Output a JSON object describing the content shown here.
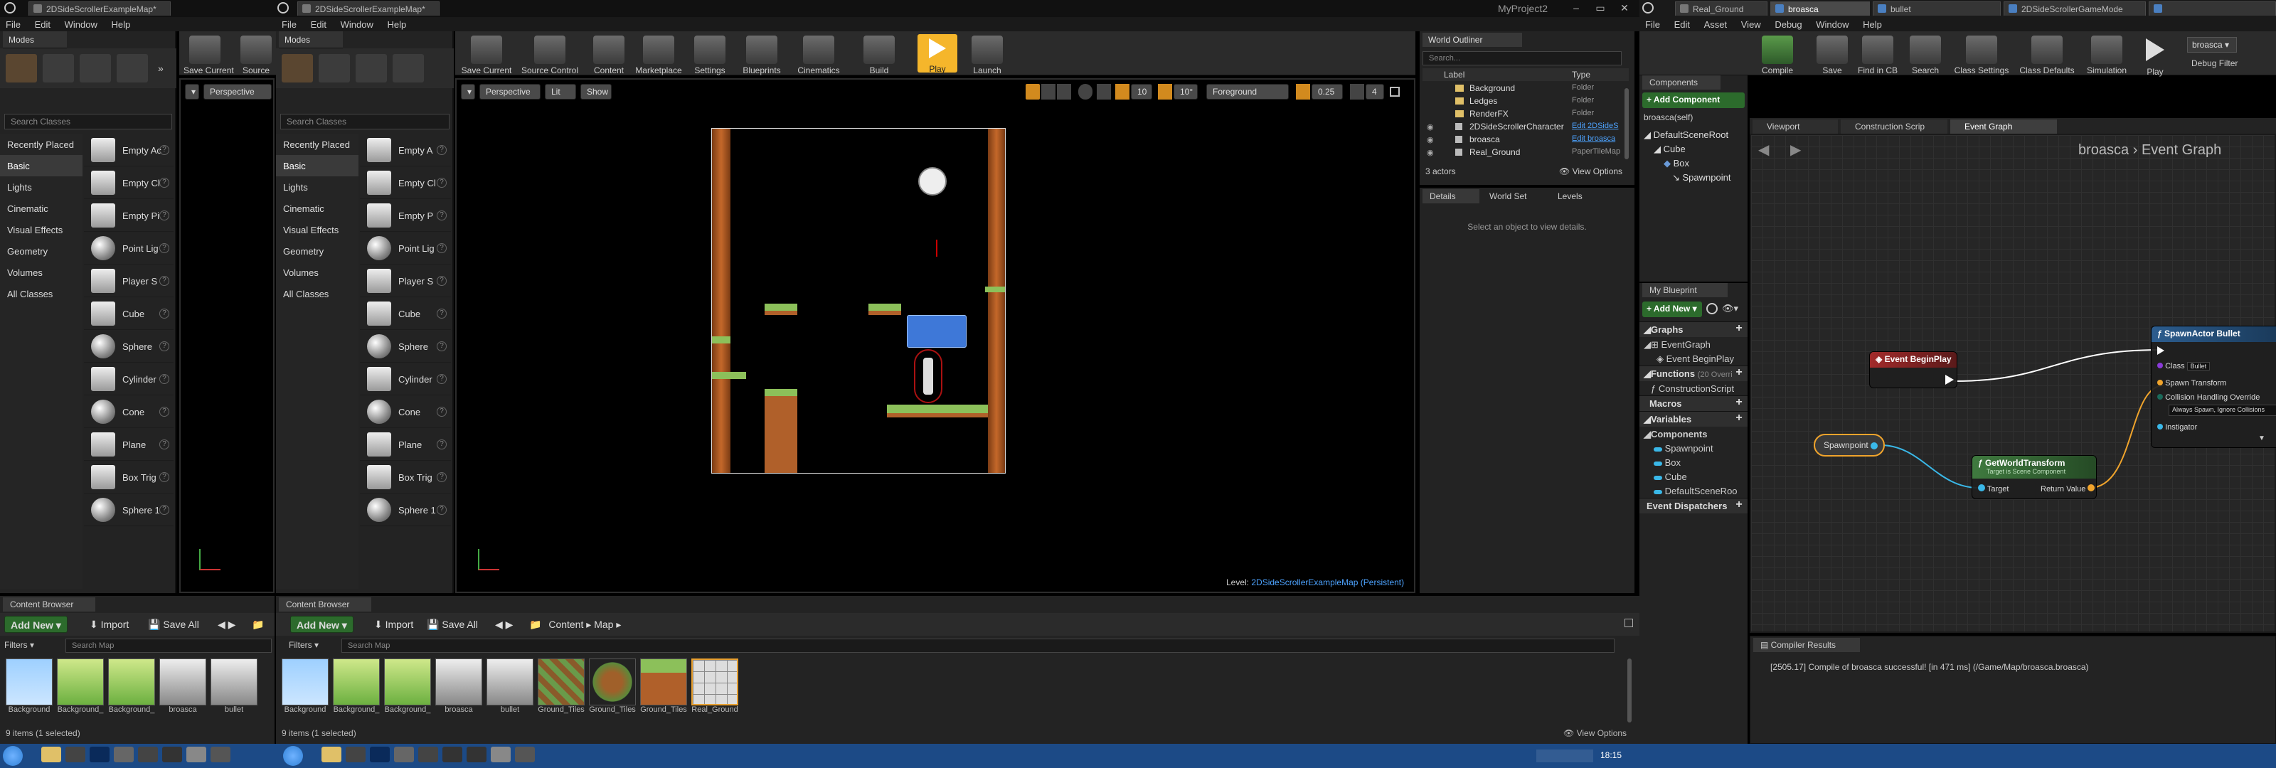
{
  "window1": {
    "tab_title": "2DSideScrollerExampleMap*",
    "modes_tab": "Modes",
    "menu": [
      "File",
      "Edit",
      "Window",
      "Help"
    ]
  },
  "window2": {
    "tab_title": "2DSideScrollerExampleMap*",
    "modes_tab": "Modes",
    "menu": [
      "File",
      "Edit",
      "Window",
      "Help"
    ],
    "project_name": "MyProject2"
  },
  "modes": {
    "search_placeholder": "Search Classes",
    "categories": [
      "Recently Placed",
      "Basic",
      "Lights",
      "Cinematic",
      "Visual Effects",
      "Geometry",
      "Volumes",
      "All Classes"
    ],
    "items": [
      "Empty A",
      "Empty Cl",
      "Empty P",
      "Point Lig",
      "Player S",
      "Cube",
      "Sphere",
      "Cylinder",
      "Cone",
      "Plane",
      "Box Trig",
      "Sphere 1"
    ],
    "items_left": [
      "Empty Ac",
      "Empty Cl",
      "Empty Pi",
      "Point Lig",
      "Player S",
      "Cube",
      "Sphere",
      "Cylinder",
      "Cone",
      "Plane",
      "Box Trig",
      "Sphere 1"
    ]
  },
  "toolbar": {
    "save_current": "Save Current",
    "source_control": "Source Control",
    "source_short": "Source",
    "content": "Content",
    "marketplace": "Marketplace",
    "settings": "Settings",
    "blueprints": "Blueprints",
    "cinematics": "Cinematics",
    "build": "Build",
    "play": "Play",
    "launch": "Launch"
  },
  "viewport": {
    "perspective": "Perspective",
    "lit": "Lit",
    "show": "Show",
    "grid_snap": "10",
    "rot_snap": "10°",
    "foreground": "Foreground",
    "scale_snap": "0.25",
    "cam_speed": "4",
    "level_label": "Level:",
    "level_name": "2DSideScrollerExampleMap (Persistent)"
  },
  "outliner": {
    "tab": "World Outliner",
    "search_placeholder": "Search...",
    "col_label": "Label",
    "col_type": "Type",
    "rows": [
      {
        "label": "Background",
        "type": "Folder"
      },
      {
        "label": "Ledges",
        "type": "Folder"
      },
      {
        "label": "RenderFX",
        "type": "Folder"
      },
      {
        "label": "2DSideScrollerCharacter",
        "type": "Edit 2DSideS"
      },
      {
        "label": "broasca",
        "type": "Edit broasca"
      },
      {
        "label": "Real_Ground",
        "type": "PaperTileMap"
      }
    ],
    "count": "3 actors",
    "view_options": "View Options"
  },
  "details": {
    "tabs": [
      "Details",
      "World Set",
      "Levels"
    ],
    "empty_msg": "Select an object to view details."
  },
  "content_browser": {
    "tab": "Content Browser",
    "add_new": "Add New",
    "import": "Import",
    "save_all": "Save All",
    "path": [
      "Content",
      "Map"
    ],
    "filters": "Filters",
    "search_placeholder": "Search Map",
    "items": [
      "Background",
      "Background_",
      "Background_",
      "broasca",
      "bullet",
      "Ground_Tiles",
      "Ground_Tiles",
      "Ground_Tiles",
      "Real_Ground"
    ],
    "status": "9 items (1 selected)",
    "view_options": "View Options"
  },
  "bp_editor": {
    "tabs": [
      "Real_Ground",
      "broasca",
      "bullet",
      "2DSideScrollerGameMode"
    ],
    "menu": [
      "File",
      "Edit",
      "Asset",
      "View",
      "Debug",
      "Window",
      "Help"
    ],
    "toolbar": [
      "Compile",
      "Save",
      "Find in CB",
      "Search",
      "Class Settings",
      "Class Defaults",
      "Simulation",
      "Play"
    ],
    "debug_object": "broasca",
    "debug_filter": "Debug Filter",
    "components_tab": "Components",
    "add_component": "+ Add Component",
    "self": "broasca(self)",
    "components": [
      "DefaultSceneRoot",
      "Cube",
      "Box",
      "Spawnpoint"
    ],
    "my_blueprint_tab": "My Blueprint",
    "add_new": "Add New",
    "graphs": "Graphs",
    "graph_items": [
      "EventGraph",
      "Event BeginPlay"
    ],
    "functions": "Functions",
    "functions_override": "(20 Overri",
    "function_items": [
      "ConstructionScript"
    ],
    "macros": "Macros",
    "variables": "Variables",
    "var_components": "Components",
    "var_items": [
      "Spawnpoint",
      "Box",
      "Cube",
      "DefaultSceneRoo"
    ],
    "dispatchers": "Event Dispatchers",
    "graph_tabs": [
      "Viewport",
      "Construction Scrip",
      "Event Graph"
    ],
    "breadcrumb_bp": "broasca",
    "breadcrumb_graph": "Event Graph",
    "compiler_tab": "Compiler Results",
    "compiler_msg": "[2505.17] Compile of broasca successful! [in 471 ms] (/Game/Map/broasca.broasca)"
  },
  "nodes": {
    "begin_play": "Event BeginPlay",
    "spawnpoint": "Spawnpoint",
    "get_world_transform": "GetWorldTransform",
    "get_world_sub": "Target is Scene Component",
    "target": "Target",
    "return_value": "Return Value",
    "spawn_actor": "SpawnActor Bullet",
    "class": "Class",
    "class_value": "Bullet",
    "spawn_transform": "Spawn Transform",
    "collision": "Collision Handling Override",
    "collision_value": "Always Spawn, Ignore Collisions",
    "instigator": "Instigator"
  },
  "taskbar": {
    "time": "18:15",
    "colors": {
      "bar": "#1c4a86",
      "start": "#2f80d6"
    }
  },
  "colors": {
    "accent_orange": "#f0a42c",
    "play_yellow": "#f5b62b",
    "event_red": "#a22a2a",
    "func_green": "#3f7a3f",
    "spawn_blue": "#2c5d8f",
    "exec_white": "#ffffff"
  }
}
